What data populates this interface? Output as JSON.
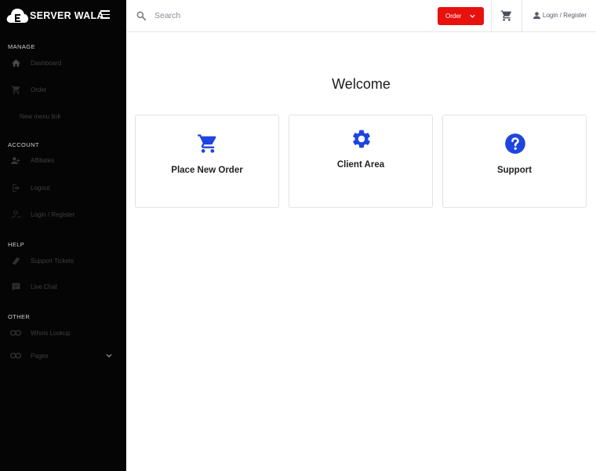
{
  "brand": {
    "name": "SERVER WALA"
  },
  "sidebar": {
    "sections": [
      {
        "label": "MANAGE"
      },
      {
        "label": "ACCOUNT"
      },
      {
        "label": "HELP"
      },
      {
        "label": "OTHER"
      }
    ],
    "items": [
      {
        "label": "Dashboard",
        "icon": "home-icon"
      },
      {
        "label": "Order",
        "icon": "cart-icon"
      },
      {
        "label": "New menu link"
      },
      {
        "label": "Affiliates",
        "icon": "people-icon"
      },
      {
        "label": "Logout",
        "icon": "logout-icon"
      },
      {
        "label": "Login / Register",
        "icon": "user-icon"
      },
      {
        "label": "Support Tickets",
        "icon": "ticket-icon"
      },
      {
        "label": "Live Chat",
        "icon": "chat-icon"
      },
      {
        "label": "Whois Lookup",
        "icon": "link-icon"
      },
      {
        "label": "Pages",
        "icon": "link-icon"
      }
    ]
  },
  "topbar": {
    "search_placeholder": "Search",
    "order_label": "Order",
    "login_label": "Login / Register"
  },
  "main": {
    "title": "Welcome",
    "cards": [
      {
        "label": "Place New Order",
        "icon": "cart-icon"
      },
      {
        "label": "Client Area",
        "icon": "gear-icon"
      },
      {
        "label": "Support",
        "icon": "question-icon"
      }
    ]
  },
  "colors": {
    "sidebar_bg": "#050505",
    "accent_red": "#e8110d",
    "icon_blue": "#1f45e0"
  }
}
